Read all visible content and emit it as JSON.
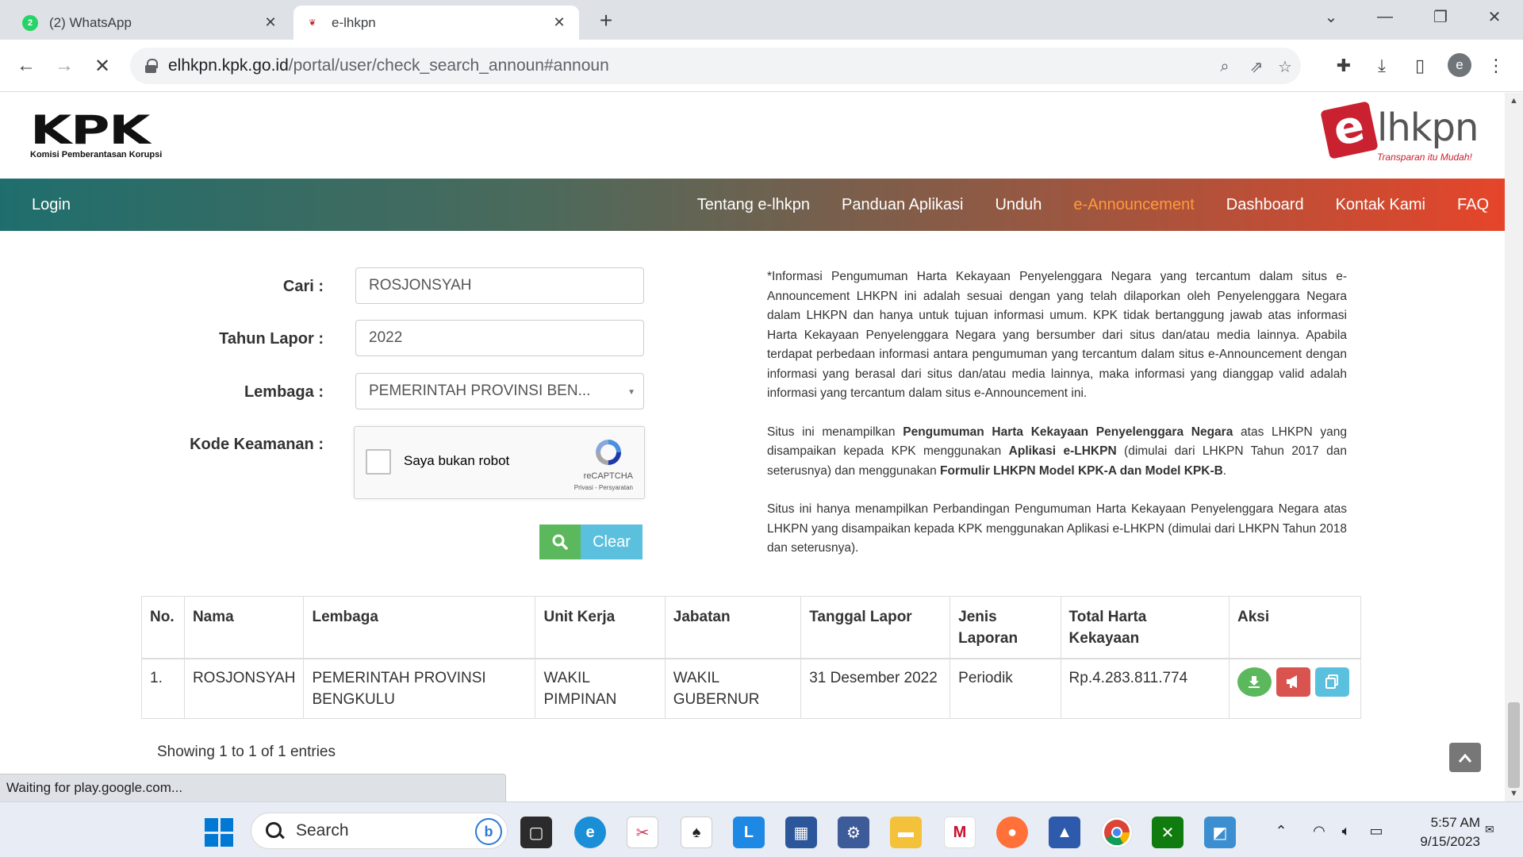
{
  "browser": {
    "tabs": [
      {
        "title": "(2) WhatsApp",
        "badge": "2",
        "icon": "whatsapp-icon"
      },
      {
        "title": "e-lhkpn",
        "icon": "kpk-favicon"
      }
    ],
    "url_host": "elhkpn.kpk.go.id",
    "url_path": "/portal/user/check_search_announ#announ",
    "profile_initial": "e",
    "status_text": "Waiting for play.google.com..."
  },
  "site": {
    "kpk_logo": "KPK",
    "kpk_subtitle": "Komisi Pemberantasan Korupsi",
    "elhkpn_logo_e": "e",
    "elhkpn_logo_rest": "lhkpn",
    "elhkpn_tagline": "Transparan itu Mudah!",
    "nav": {
      "login": "Login",
      "items": [
        "Tentang e-lhkpn",
        "Panduan Aplikasi",
        "Unduh",
        "e-Announcement",
        "Dashboard",
        "Kontak Kami",
        "FAQ"
      ],
      "active_index": 3,
      "active_color": "#ff9a3c"
    }
  },
  "form": {
    "cari_label": "Cari :",
    "cari_value": "ROSJONSYAH",
    "tahun_label": "Tahun Lapor :",
    "tahun_value": "2022",
    "lembaga_label": "Lembaga :",
    "lembaga_value": "PEMERINTAH PROVINSI BEN...",
    "kode_label": "Kode Keamanan :",
    "recaptcha_label": "Saya bukan robot",
    "recaptcha_brand": "reCAPTCHA",
    "recaptcha_terms": "Privasi - Persyaratan",
    "clear_label": "Clear"
  },
  "info": {
    "p1": "*Informasi Pengumuman Harta Kekayaan Penyelenggara Negara yang tercantum dalam situs e-Announcement LHKPN ini adalah sesuai dengan yang telah dilaporkan oleh Penyelenggara Negara dalam LHKPN dan hanya untuk tujuan informasi umum. KPK tidak bertanggung jawab atas informasi Harta Kekayaan Penyelenggara Negara yang bersumber dari situs dan/atau media lainnya. Apabila terdapat perbedaan informasi antara pengumuman yang tercantum dalam situs e-Announcement dengan informasi yang berasal dari situs dan/atau media lainnya, maka informasi yang dianggap valid adalah informasi yang tercantum dalam situs e-Announcement ini.",
    "p2_a": "Situs ini menampilkan ",
    "p2_b": "Pengumuman Harta Kekayaan Penyelenggara Negara",
    "p2_c": " atas LHKPN yang disampaikan kepada KPK menggunakan ",
    "p2_d": "Aplikasi e-LHKPN",
    "p2_e": " (dimulai dari LHKPN Tahun 2017 dan seterusnya) dan menggunakan ",
    "p2_f": "Formulir LHKPN Model KPK-A dan Model KPK-B",
    "p2_g": ".",
    "p3": "Situs ini hanya menampilkan Perbandingan Pengumuman Harta Kekayaan Penyelenggara Negara atas LHKPN yang disampaikan kepada KPK menggunakan Aplikasi e-LHKPN (dimulai dari LHKPN Tahun 2018 dan seterusnya)."
  },
  "table": {
    "headers": [
      "No.",
      "Nama",
      "Lembaga",
      "Unit Kerja",
      "Jabatan",
      "Tanggal Lapor",
      "Jenis Laporan",
      "Total Harta Kekayaan",
      "Aksi"
    ],
    "rows": [
      {
        "no": "1.",
        "nama": "ROSJONSYAH",
        "lembaga": "PEMERINTAH PROVINSI BENGKULU",
        "unit_kerja": "WAKIL PIMPINAN",
        "jabatan": "WAKIL GUBERNUR",
        "tanggal": "31 Desember 2022",
        "jenis": "Periodik",
        "total": "Rp.4.283.811.774"
      }
    ],
    "showing": "Showing 1 to 1 of 1 entries"
  },
  "taskbar": {
    "search_placeholder": "Search",
    "time": "5:57 AM",
    "date": "9/15/2023"
  }
}
